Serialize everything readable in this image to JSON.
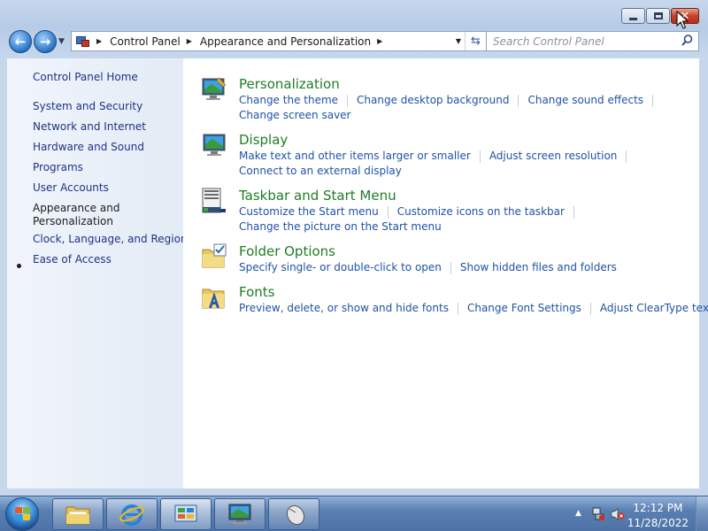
{
  "window": {
    "min_label": "minimize",
    "max_label": "maximize",
    "close_label": "close"
  },
  "nav": {
    "breadcrumbs": [
      "Control Panel",
      "Appearance and Personalization"
    ],
    "search_placeholder": "Search Control Panel"
  },
  "sidebar": {
    "home": "Control Panel Home",
    "items": [
      "System and Security",
      "Network and Internet",
      "Hardware and Sound",
      "Programs",
      "User Accounts",
      "Appearance and",
      "Personalization",
      "Clock, Language, and Region",
      "Ease of Access"
    ]
  },
  "categories": [
    {
      "title": "Personalization",
      "icon": "personalization-icon",
      "tasks": [
        [
          "Change the theme",
          "Change desktop background",
          "Change sound effects"
        ],
        [
          "Change screen saver"
        ]
      ]
    },
    {
      "title": "Display",
      "icon": "display-icon",
      "tasks": [
        [
          "Make text and other items larger or smaller",
          "Adjust screen resolution"
        ],
        [
          "Connect to an external display"
        ]
      ]
    },
    {
      "title": "Taskbar and Start Menu",
      "icon": "taskbar-icon",
      "tasks": [
        [
          "Customize the Start menu",
          "Customize icons on the taskbar"
        ],
        [
          "Change the picture on the Start menu"
        ]
      ]
    },
    {
      "title": "Folder Options",
      "icon": "folder-options-icon",
      "tasks": [
        [
          "Specify single- or double-click to open",
          "Show hidden files and folders"
        ]
      ]
    },
    {
      "title": "Fonts",
      "icon": "fonts-icon",
      "tasks": [
        [
          "Preview, delete, or show and hide fonts",
          "Change Font Settings",
          "Adjust ClearType text"
        ]
      ]
    }
  ],
  "taskbar": {
    "time": "12:12 PM",
    "date": "11/28/2022",
    "pinned": [
      "file-explorer-icon",
      "internet-explorer-icon",
      "control-panel-icon",
      "display-settings-icon",
      "mouse-icon"
    ]
  },
  "colors": {
    "category_title": "#1f7c25",
    "task_link": "#1e52a6",
    "sidebar_link": "#1e3287"
  }
}
